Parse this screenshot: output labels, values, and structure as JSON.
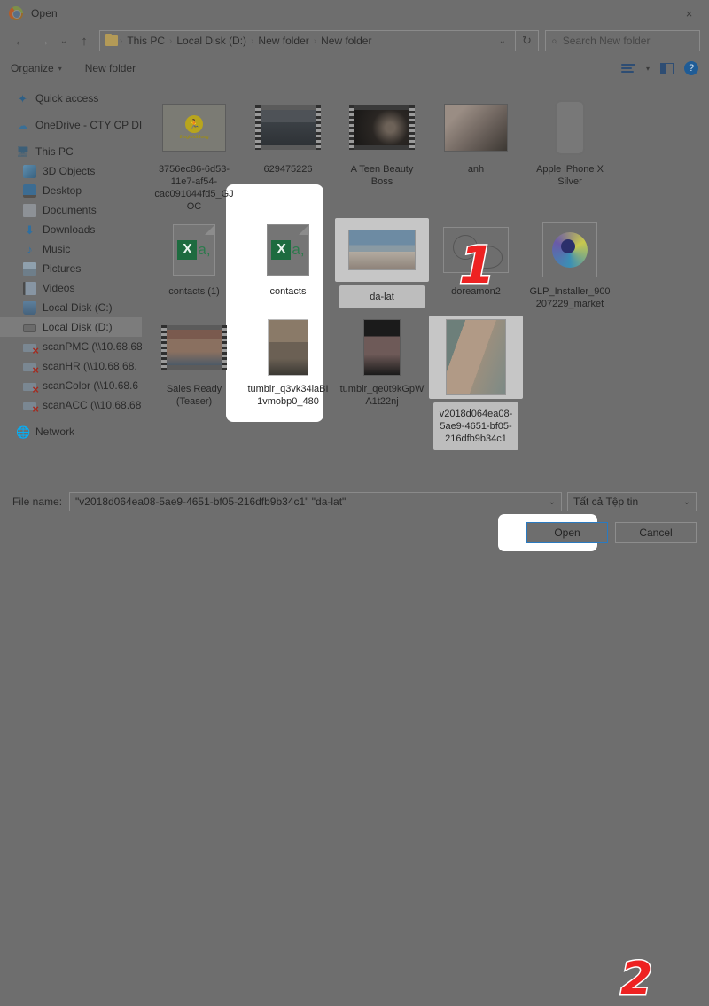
{
  "window": {
    "title": "Open",
    "app_icon": "chrome-icon",
    "close_label": "×"
  },
  "nav": {
    "back": "←",
    "forward": "→",
    "recent": "⌄",
    "up": "↑",
    "refresh": "↻",
    "address_chevron": "⌄",
    "breadcrumbs": [
      "This PC",
      "Local Disk (D:)",
      "New folder",
      "New folder"
    ],
    "separator": "›"
  },
  "search": {
    "placeholder": "Search New folder",
    "icon": "search-icon"
  },
  "toolbar": {
    "organize": "Organize",
    "organize_caret": "▾",
    "new_folder": "New folder",
    "view_caret": "▾",
    "help": "?"
  },
  "sidebar": {
    "items": [
      {
        "label": "Quick access",
        "icon": "star-icon",
        "level": 1,
        "selected": false
      },
      {
        "label": "OneDrive - CTY CP DI",
        "icon": "cloud-icon",
        "level": 1,
        "selected": false
      },
      {
        "label": "This PC",
        "icon": "computer-icon",
        "level": 1,
        "selected": false
      },
      {
        "label": "3D Objects",
        "icon": "3d-objects-icon",
        "level": 2,
        "selected": false
      },
      {
        "label": "Desktop",
        "icon": "desktop-icon",
        "level": 2,
        "selected": false
      },
      {
        "label": "Documents",
        "icon": "documents-icon",
        "level": 2,
        "selected": false
      },
      {
        "label": "Downloads",
        "icon": "downloads-icon",
        "level": 2,
        "selected": false
      },
      {
        "label": "Music",
        "icon": "music-icon",
        "level": 2,
        "selected": false
      },
      {
        "label": "Pictures",
        "icon": "pictures-icon",
        "level": 2,
        "selected": false
      },
      {
        "label": "Videos",
        "icon": "videos-icon",
        "level": 2,
        "selected": false
      },
      {
        "label": "Local Disk (C:)",
        "icon": "disk-icon",
        "level": 2,
        "selected": false
      },
      {
        "label": "Local Disk (D:)",
        "icon": "disk-icon",
        "level": 2,
        "selected": true
      },
      {
        "label": "scanPMC (\\\\10.68.68",
        "icon": "network-drive-disconnected-icon",
        "level": 2,
        "selected": false
      },
      {
        "label": "scanHR (\\\\10.68.68.",
        "icon": "network-drive-disconnected-icon",
        "level": 2,
        "selected": false
      },
      {
        "label": "scanColor (\\\\10.68.6",
        "icon": "network-drive-disconnected-icon",
        "level": 2,
        "selected": false
      },
      {
        "label": "scanACC (\\\\10.68.68",
        "icon": "network-drive-disconnected-icon",
        "level": 2,
        "selected": false
      },
      {
        "label": "Network",
        "icon": "network-icon",
        "level": 1,
        "selected": false
      }
    ]
  },
  "files": [
    {
      "name": "3756ec86-6d53-11e7-af54-cac091044fd5_GJOC",
      "thumb": "logo-thumbnail",
      "selected": false
    },
    {
      "name": "629475226",
      "thumb": "video-thumbnail",
      "selected": false
    },
    {
      "name": "A Teen Beauty Boss",
      "thumb": "video-thumbnail",
      "selected": false
    },
    {
      "name": "anh",
      "thumb": "photo-thumbnail",
      "selected": false
    },
    {
      "name": "Apple iPhone X Silver",
      "thumb": "phone-thumbnail",
      "selected": false
    },
    {
      "name": "contacts (1)",
      "thumb": "excel-file-icon",
      "selected": false
    },
    {
      "name": "contacts",
      "thumb": "excel-file-icon",
      "selected": false
    },
    {
      "name": "da-lat",
      "thumb": "photo-thumbnail",
      "selected": true
    },
    {
      "name": "doreamon2",
      "thumb": "drawing-thumbnail",
      "selected": false
    },
    {
      "name": "GLP_Installer_900207229_market",
      "thumb": "installer-icon",
      "selected": false
    },
    {
      "name": "Sales Ready (Teaser)",
      "thumb": "video-thumbnail",
      "selected": false
    },
    {
      "name": "tumblr_q3vk34iaBI1vmobp0_480",
      "thumb": "photo-thumbnail",
      "selected": false
    },
    {
      "name": "tumblr_qe0t9kGpWA1t22nj",
      "thumb": "photo-thumbnail",
      "selected": false
    },
    {
      "name": "v2018d064ea08-5ae9-4651-bf05-216dfb9b34c1",
      "thumb": "photo-thumbnail",
      "selected": true
    }
  ],
  "bottom": {
    "filename_label": "File name:",
    "filename_value": "\"v2018d064ea08-5ae9-4651-bf05-216dfb9b34c1\" \"da-lat\"",
    "filename_chevron": "⌄",
    "filter_value": "Tất cả Tệp tin",
    "filter_chevron": "⌄",
    "open_button": "Open",
    "cancel_button": "Cancel"
  },
  "annotations": [
    {
      "id": "1",
      "text": "1"
    },
    {
      "id": "2",
      "text": "2"
    }
  ],
  "colors": {
    "dim_overlay": "#6e6e6e",
    "accent_blue": "#2a7ac0",
    "marker_red": "#ee2222",
    "spotlight_white": "#ffffff"
  }
}
